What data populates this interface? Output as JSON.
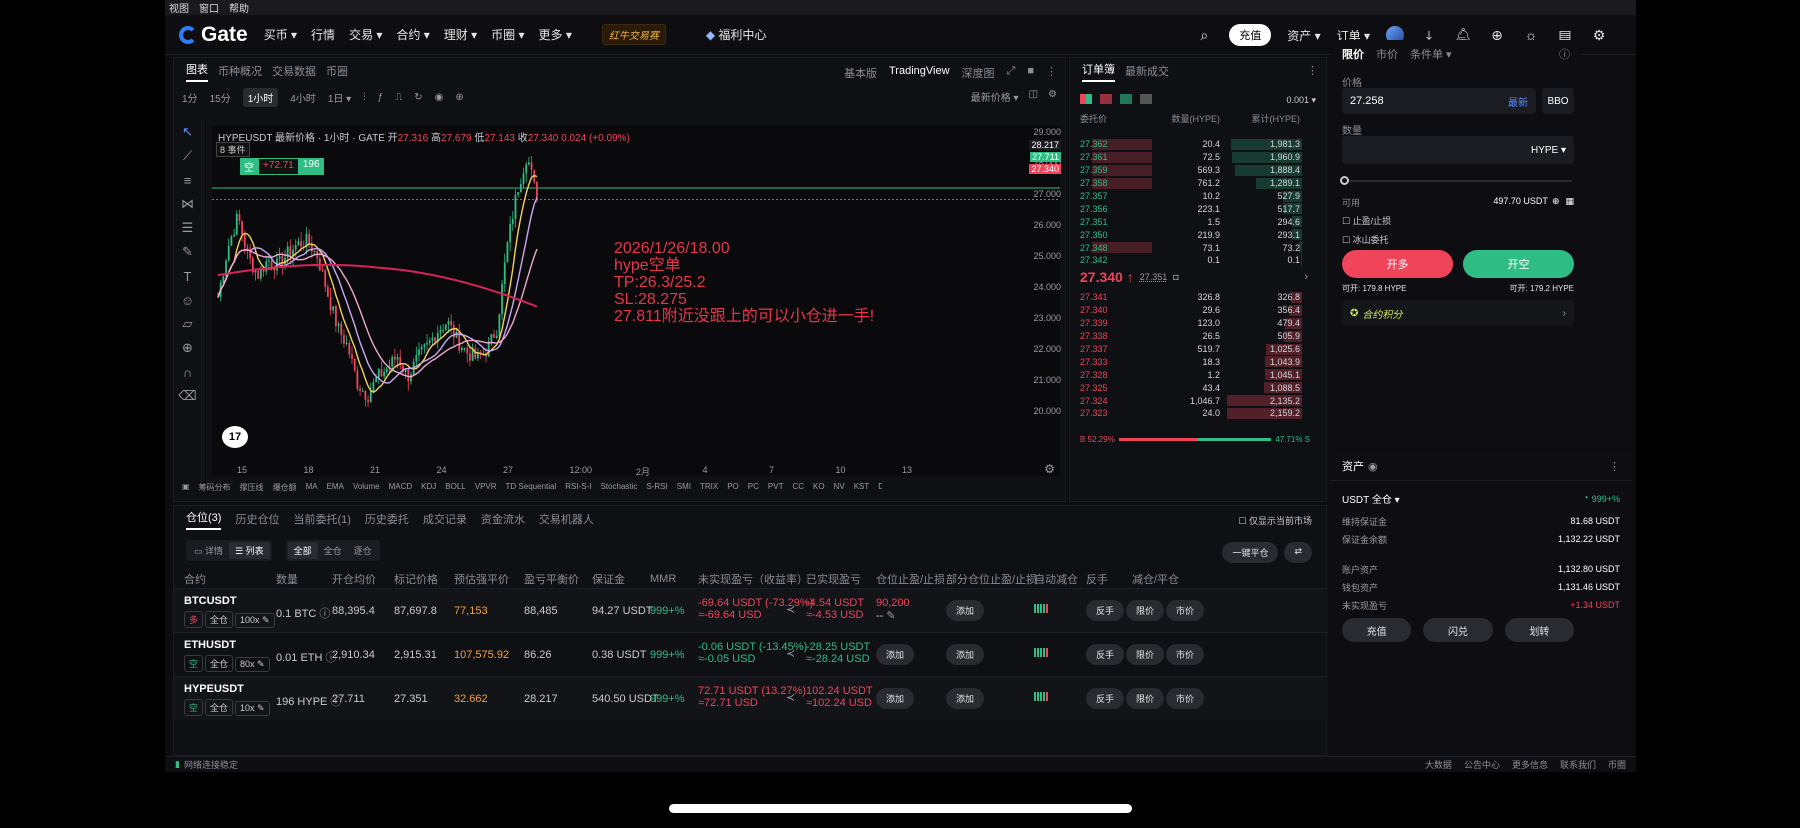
{
  "menubar": {
    "items": [
      "视图",
      "窗口",
      "帮助"
    ]
  },
  "topnav": {
    "brand": "Gate",
    "items": [
      "买币 ▾",
      "行情",
      "交易 ▾",
      "合约 ▾",
      "理财 ▾",
      "币圈 ▾",
      "更多 ▾"
    ],
    "promo": "红牛交易赛",
    "welfare": "福利中心",
    "deposit": "充值",
    "assets": "资产 ▾",
    "orders": "订单 ▾"
  },
  "chart_panel": {
    "tabs": [
      "图表",
      "币种概况",
      "交易数据",
      "币圈"
    ],
    "views": [
      "基本版",
      "TradingView",
      "深度图"
    ],
    "intervals": [
      "1分",
      "15分",
      "1小时",
      "4小时",
      "1日 ▾"
    ],
    "latest_price_label": "最新价格 ▾",
    "symbol_line": "HYPEUSDT 最新价格 · 1小时 · GATE",
    "ohlc": {
      "open_label": "开",
      "open": "27.316",
      "high_label": "高",
      "high": "27.679",
      "low_label": "低",
      "low": "27.143",
      "close_label": "收",
      "close": "27.340",
      "change": "0.024 (+0.09%)"
    },
    "position_tag": {
      "side": "空",
      "pnl": "+72.71",
      "qty": "196"
    },
    "indicator_count": "8",
    "indicator_label": "事件",
    "price_levels": [
      "29.000",
      "28.000",
      "27.000",
      "26.000",
      "25.000",
      "24.000",
      "23.000",
      "22.000",
      "21.000",
      "20.000"
    ],
    "price_tags": {
      "entry": "28.217",
      "mark": "27.711",
      "last": "27.340"
    },
    "time_labels": [
      "15",
      "18",
      "21",
      "24",
      "27",
      "12:00",
      "2月",
      "4",
      "7",
      "10",
      "13"
    ],
    "annotation": [
      "2026/1/26/18.00",
      "hype空单",
      "TP:26.3/25.2",
      "SL:28.275",
      "27.811附近没跟上的可以小仓进一手!"
    ],
    "indicators": [
      "筹码分布",
      "撑压线",
      "爆仓额",
      "MA",
      "EMA",
      "Volume",
      "MACD",
      "KDJ",
      "BOLL",
      "VPVR",
      "TD Sequential",
      "RSI-S-I",
      "Stochastic",
      "S-RSI",
      "SMI",
      "TRIX",
      "PO",
      "PC",
      "PVT",
      "CC",
      "KO",
      "NV",
      "KST",
      "DM",
      "S"
    ]
  },
  "orderbook": {
    "tabs": [
      "订单簿",
      "最新成交"
    ],
    "precision": "0.001 ▾",
    "headers": [
      "委托价",
      "数量(HYPE)",
      "累计(HYPE)"
    ],
    "asks": [
      {
        "p": "27.362",
        "a": "20.4",
        "c": "1,981.3",
        "d": 0.5,
        "w": 0.95
      },
      {
        "p": "27.361",
        "a": "72.5",
        "c": "1,960.9",
        "d": 0.5,
        "w": 0.94
      },
      {
        "p": "27.359",
        "a": "569.3",
        "c": "1,888.4",
        "d": 0.5,
        "w": 0.9
      },
      {
        "p": "27.358",
        "a": "761.2",
        "c": "1,289.1",
        "d": 0.5,
        "w": 0.62
      },
      {
        "p": "27.357",
        "a": "10.2",
        "c": "527.9",
        "d": 0,
        "w": 0.26
      },
      {
        "p": "27.356",
        "a": "223.1",
        "c": "517.7",
        "d": 0,
        "w": 0.25
      },
      {
        "p": "27.351",
        "a": "1.5",
        "c": "294.6",
        "d": 0,
        "w": 0.14
      },
      {
        "p": "27.350",
        "a": "219.9",
        "c": "293.1",
        "d": 0,
        "w": 0.14
      },
      {
        "p": "27.348",
        "a": "73.1",
        "c": "73.2",
        "d": 0.5,
        "w": 0.04
      },
      {
        "p": "27.342",
        "a": "0.1",
        "c": "0.1",
        "d": 0,
        "w": 0.01
      }
    ],
    "last_price": "27.340 ↑",
    "mark_price": "27.351",
    "bids": [
      {
        "p": "27.341",
        "a": "326.8",
        "c": "326.8",
        "w": 0.15
      },
      {
        "p": "27.340",
        "a": "29.6",
        "c": "356.4",
        "w": 0.17
      },
      {
        "p": "27.339",
        "a": "123.0",
        "c": "479.4",
        "w": 0.23
      },
      {
        "p": "27.338",
        "a": "26.5",
        "c": "505.9",
        "w": 0.24
      },
      {
        "p": "27.337",
        "a": "519.7",
        "c": "1,025.6",
        "w": 0.48
      },
      {
        "p": "27.333",
        "a": "18.3",
        "c": "1,043.9",
        "w": 0.49
      },
      {
        "p": "27.328",
        "a": "1.2",
        "c": "1,045.1",
        "w": 0.49
      },
      {
        "p": "27.325",
        "a": "43.4",
        "c": "1,088.5",
        "w": 0.51
      },
      {
        "p": "27.324",
        "a": "1,046.7",
        "c": "2,135.2",
        "w": 1.0
      },
      {
        "p": "27.323",
        "a": "24.0",
        "c": "2,159.2",
        "w": 1.0
      }
    ],
    "buy_ratio": "B 52.29%",
    "sell_ratio": "47.71% S",
    "buy_fraction": 0.5229
  },
  "order_form": {
    "tabs": [
      "限价",
      "市价",
      "条件单 ▾"
    ],
    "price_label": "价格",
    "price_value": "27.258",
    "latest_btn": "最新",
    "bbo_btn": "BBO",
    "qty_label": "数量",
    "qty_unit": "HYPE ▾",
    "available_label": "可用",
    "available_value": "497.70 USDT",
    "tp_sl": "止盈/止损",
    "iceberg": "冰山委托",
    "open_long": "开多",
    "open_short": "开空",
    "can_open_long": "可开: 179.8 HYPE",
    "can_open_short": "可开: 179.2 HYPE",
    "points": "合约积分"
  },
  "positions": {
    "tabs": [
      "仓位(3)",
      "历史仓位",
      "当前委托(1)",
      "历史委托",
      "成交记录",
      "资金流水",
      "交易机器人"
    ],
    "only_current": "仅显示当前市场",
    "views": [
      "详情",
      "列表"
    ],
    "filters": [
      "全部",
      "全仓",
      "逐仓"
    ],
    "close_all": "一键平仓",
    "headers": [
      "合约",
      "数量",
      "开仓均价",
      "标记价格",
      "预估强平价",
      "盈亏平衡价",
      "保证金",
      "MMR",
      "未实现盈亏（收益率）",
      "已实现盈亏",
      "仓位止盈/止损",
      "部分仓位止盈/止损",
      "自动减仓",
      "反手",
      "减仓/平仓"
    ],
    "rows": [
      {
        "symbol": "BTCUSDT",
        "side": "多",
        "mode": "全仓",
        "lev": "100x",
        "qty": "0.1 BTC",
        "entry": "88,395.4",
        "mark": "87,697.8",
        "liq": "77,153",
        "be": "88,485",
        "margin": "94.27 USDT",
        "mmr": "999+%",
        "upnl": "-69.64 USDT (-73.29%)",
        "upnl_usd": "≈-69.64 USD",
        "rpnl": "-4.54 USDT",
        "rpnl_usd": "≈-4.53 USD",
        "tpsl": "90,200",
        "tpsl2": "--",
        "tpsl_btn": "",
        "partial": "添加",
        "reverse": "反手",
        "limit": "限价",
        "market": "市价",
        "upnl_color": "#f0445a",
        "rpnl_color": "#f0445a",
        "side_color": "#f0445a"
      },
      {
        "symbol": "ETHUSDT",
        "side": "空",
        "mode": "全仓",
        "lev": "80x",
        "qty": "0.01 ETH",
        "entry": "2,910.34",
        "mark": "2,915.31",
        "liq": "107,575.92",
        "be": "86.26",
        "margin": "0.38 USDT",
        "mmr": "999+%",
        "upnl": "-0.06 USDT (-13.45%)",
        "upnl_usd": "≈-0.05 USD",
        "rpnl": "-28.25 USDT",
        "rpnl_usd": "≈-28.24 USD",
        "tpsl": "",
        "tpsl2": "",
        "tpsl_btn": "添加",
        "partial": "添加",
        "reverse": "反手",
        "limit": "限价",
        "market": "市价",
        "upnl_color": "#2fbd85",
        "rpnl_color": "#2fbd85",
        "side_color": "#2fbd85"
      },
      {
        "symbol": "HYPEUSDT",
        "side": "空",
        "mode": "全仓",
        "lev": "10x",
        "qty": "196 HYPE",
        "entry": "27.711",
        "mark": "27.351",
        "liq": "32.662",
        "be": "28.217",
        "margin": "540.50 USDT",
        "mmr": "999+%",
        "upnl": "72.71 USDT (13.27%)",
        "upnl_usd": "≈72.71 USD",
        "rpnl": "102.24 USDT",
        "rpnl_usd": "≈102.24 USD",
        "tpsl": "",
        "tpsl2": "",
        "tpsl_btn": "添加",
        "partial": "添加",
        "reverse": "反手",
        "limit": "限价",
        "market": "市价",
        "upnl_color": "#f0445a",
        "rpnl_color": "#f0445a",
        "side_color": "#2fbd85"
      }
    ]
  },
  "assets": {
    "title": "资产",
    "account": "USDT 全仓 ▾",
    "ratio": "999+%",
    "rows": [
      {
        "label": "维持保证金",
        "value": "81.68 USDT"
      },
      {
        "label": "保证金余额",
        "value": "1,132.22 USDT"
      },
      {
        "label": "账户资产",
        "value": "1,132.80 USDT"
      },
      {
        "label": "钱包资产",
        "value": "1,131.46 USDT"
      },
      {
        "label": "未实现盈亏",
        "value": "+1.34 USDT"
      }
    ],
    "buttons": [
      "充值",
      "闪兑",
      "划转"
    ]
  },
  "statusbar": {
    "network": "网络连接稳定",
    "links": [
      "大数据",
      "公告中心",
      "更多信息",
      "联系我们",
      "币圈"
    ]
  }
}
